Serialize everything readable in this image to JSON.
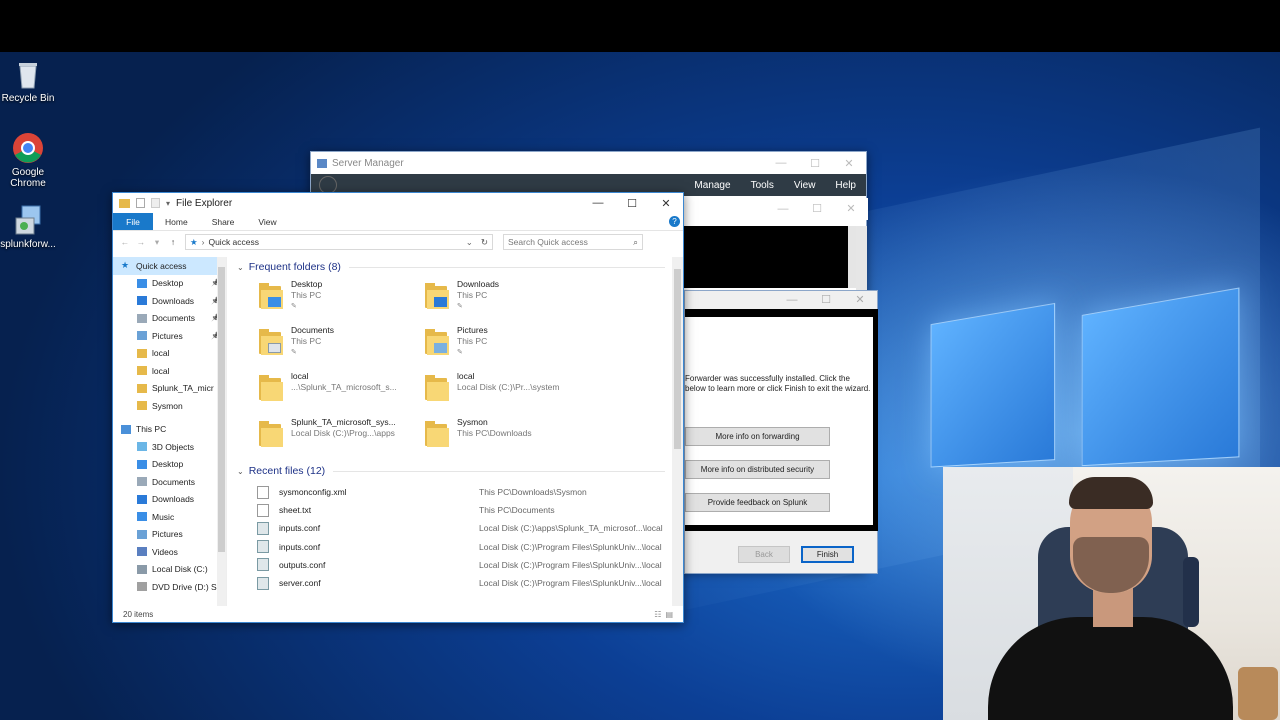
{
  "desktop": {
    "icons": [
      {
        "label": "Recycle Bin",
        "icon": "recycle-bin-icon"
      },
      {
        "label": "Google Chrome",
        "icon": "chrome-icon"
      },
      {
        "label": "splunkforw...",
        "icon": "installer-icon"
      }
    ]
  },
  "server_manager": {
    "title": "Server Manager",
    "menu": [
      "Manage",
      "Tools",
      "View",
      "Help"
    ]
  },
  "wizard": {
    "message": "Forwarder was successfully installed. Click the below to learn more or click Finish to exit the wizard.",
    "buttons": [
      "More info on forwarding",
      "More info on distributed security",
      "Provide feedback on Splunk"
    ],
    "back_label": "Back",
    "finish_label": "Finish"
  },
  "explorer": {
    "title": "File Explorer",
    "ribbon": {
      "file": "File",
      "tabs": [
        "Home",
        "Share",
        "View"
      ],
      "help": "?"
    },
    "address": "Quick access",
    "search_placeholder": "Search Quick access",
    "nav": [
      {
        "label": "Quick access",
        "icon": "star-icon",
        "level": "root",
        "selected": true,
        "pinned": false
      },
      {
        "label": "Desktop",
        "icon": "desktop-icon",
        "pinned": true
      },
      {
        "label": "Downloads",
        "icon": "download-icon",
        "pinned": true
      },
      {
        "label": "Documents",
        "icon": "documents-icon",
        "pinned": true
      },
      {
        "label": "Pictures",
        "icon": "pictures-icon",
        "pinned": true
      },
      {
        "label": "local",
        "icon": "folder-icon",
        "pinned": false
      },
      {
        "label": "local",
        "icon": "folder-icon",
        "pinned": false
      },
      {
        "label": "Splunk_TA_micr",
        "icon": "folder-icon",
        "pinned": false
      },
      {
        "label": "Sysmon",
        "icon": "folder-icon",
        "pinned": false
      },
      {
        "label": "This PC",
        "icon": "computer-icon",
        "level": "root",
        "pinned": false
      },
      {
        "label": "3D Objects",
        "icon": "3d-objects-icon",
        "pinned": false
      },
      {
        "label": "Desktop",
        "icon": "desktop-icon",
        "pinned": false
      },
      {
        "label": "Documents",
        "icon": "documents-icon",
        "pinned": false
      },
      {
        "label": "Downloads",
        "icon": "download-icon",
        "pinned": false
      },
      {
        "label": "Music",
        "icon": "music-icon",
        "pinned": false
      },
      {
        "label": "Pictures",
        "icon": "pictures-icon",
        "pinned": false
      },
      {
        "label": "Videos",
        "icon": "videos-icon",
        "pinned": false
      },
      {
        "label": "Local Disk (C:)",
        "icon": "disk-icon",
        "pinned": false
      },
      {
        "label": "DVD Drive (D:) S",
        "icon": "dvd-icon",
        "pinned": false
      }
    ],
    "frequent_header": "Frequent folders (8)",
    "frequent": [
      {
        "name": "Desktop",
        "sub": "This PC",
        "pinned": true,
        "badge": "desktop"
      },
      {
        "name": "Downloads",
        "sub": "This PC",
        "pinned": true,
        "badge": "download"
      },
      {
        "name": "Documents",
        "sub": "This PC",
        "pinned": true,
        "badge": "documents"
      },
      {
        "name": "Pictures",
        "sub": "This PC",
        "pinned": true,
        "badge": "pictures"
      },
      {
        "name": "local",
        "sub": "...\\Splunk_TA_microsoft_s...",
        "pinned": false,
        "badge": ""
      },
      {
        "name": "local",
        "sub": "Local Disk (C:)\\Pr...\\system",
        "pinned": false,
        "badge": ""
      },
      {
        "name": "Splunk_TA_microsoft_sys...",
        "sub": "Local Disk (C:)\\Prog...\\apps",
        "pinned": false,
        "badge": ""
      },
      {
        "name": "Sysmon",
        "sub": "This PC\\Downloads",
        "pinned": false,
        "badge": ""
      }
    ],
    "recent_header": "Recent files (12)",
    "recent": [
      {
        "name": "sysmonconfig.xml",
        "path": "This PC\\Downloads\\Sysmon",
        "type": "xml"
      },
      {
        "name": "sheet.txt",
        "path": "This PC\\Documents",
        "type": "txt"
      },
      {
        "name": "inputs.conf",
        "path": "Local Disk (C:)\\apps\\Splunk_TA_microsof...\\local",
        "type": "cfg"
      },
      {
        "name": "inputs.conf",
        "path": "Local Disk (C:)\\Program Files\\SplunkUniv...\\local",
        "type": "cfg"
      },
      {
        "name": "outputs.conf",
        "path": "Local Disk (C:)\\Program Files\\SplunkUniv...\\local",
        "type": "cfg"
      },
      {
        "name": "server.conf",
        "path": "Local Disk (C:)\\Program Files\\SplunkUniv...\\local",
        "type": "cfg"
      }
    ],
    "status": "20 items"
  },
  "colors": {
    "accent": "#1979ca",
    "section_header": "#1e3287",
    "selection": "#cce8ff"
  }
}
